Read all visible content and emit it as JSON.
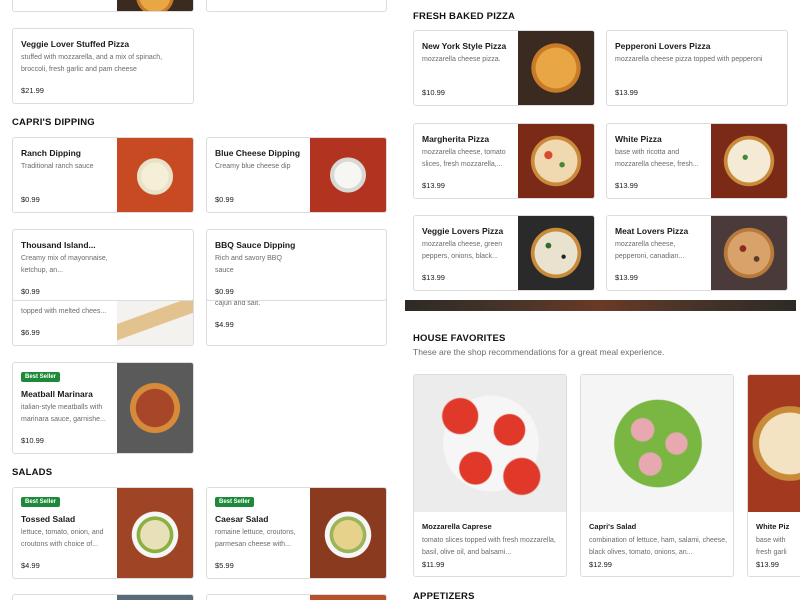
{
  "left": {
    "top_item": {
      "title": "Veggie Lover Stuffed Pizza",
      "desc": "stuffed with mozzarella, and a mix of spinach, broccoli, fresh garlic and pam cheese",
      "price": "$21.99"
    },
    "capris_dipping": {
      "title": "CAPRI'S DIPPING",
      "items": [
        {
          "title": "Ranch Dipping",
          "desc": "Traditional ranch sauce",
          "price": "$0.99"
        },
        {
          "title": "Blue Cheese Dipping",
          "desc": "Creamy blue cheese dip",
          "price": "$0.99"
        },
        {
          "title": "Thousand Island...",
          "desc": "Creamy mix of mayonnaise, ketchup, an...",
          "price": "$0.99"
        },
        {
          "title": "BBQ Sauce Dipping",
          "desc": "Rich and savory BBQ sauce",
          "price": "$0.99"
        }
      ]
    },
    "overlap": {
      "left_desc": "topped with melted chees...",
      "left_price": "$6.99",
      "right_desc": "cajun and salt.",
      "right_price": "$4.99"
    },
    "meatball": {
      "badge": "Best Seller",
      "title": "Meatball Marinara",
      "desc": "italian-style meatballs with marinara sauce, garnishe...",
      "price": "$10.99"
    },
    "salads": {
      "title": "SALADS",
      "items": [
        {
          "badge": "Best Seller",
          "title": "Tossed Salad",
          "desc": "lettuce, tomato, onion, and croutons with choice of...",
          "price": "$4.99"
        },
        {
          "badge": "Best Seller",
          "title": "Caesar Salad",
          "desc": "romaine lettuce, croutons, parmesan cheese with...",
          "price": "$5.99"
        }
      ]
    }
  },
  "right": {
    "fresh_baked": {
      "title": "FRESH BAKED PIZZA",
      "items": [
        {
          "title": "New York Style Pizza",
          "desc": "mozzarella cheese pizza.",
          "price": "$10.99"
        },
        {
          "title": "Pepperoni Lovers Pizza",
          "desc": "mozzarella cheese pizza topped with pepperoni",
          "price": "$13.99"
        },
        {
          "title": "Margherita Pizza",
          "desc": "mozzarella cheese, tomato slices, fresh mozzarella,...",
          "price": "$13.99"
        },
        {
          "title": "White Pizza",
          "desc": "base with ricotta and mozzarella cheese, fresh...",
          "price": "$13.99"
        },
        {
          "title": "Veggie Lovers Pizza",
          "desc": "mozzarella cheese, green peppers, onions, black...",
          "price": "$13.99"
        },
        {
          "title": "Meat Lovers Pizza",
          "desc": "mozzarella cheese, pepperoni, canadian...",
          "price": "$13.99"
        }
      ]
    },
    "house_favorites": {
      "title": "HOUSE FAVORITES",
      "subtitle": "These are the shop recommendations for a great meal experience.",
      "items": [
        {
          "title": "Mozzarella Caprese",
          "desc": "tomato slices topped with fresh mozzarella, basil, olive oil, and balsami...",
          "price": "$11.99"
        },
        {
          "title": "Capri's Salad",
          "desc": "combination of lettuce, ham, salami, cheese, black olives, tomato, onions, an...",
          "price": "$12.99"
        },
        {
          "title": "White Piz",
          "desc": "base with fresh garli",
          "price": "$13.99"
        }
      ]
    },
    "appetizers": {
      "title": "APPETIZERS"
    }
  }
}
